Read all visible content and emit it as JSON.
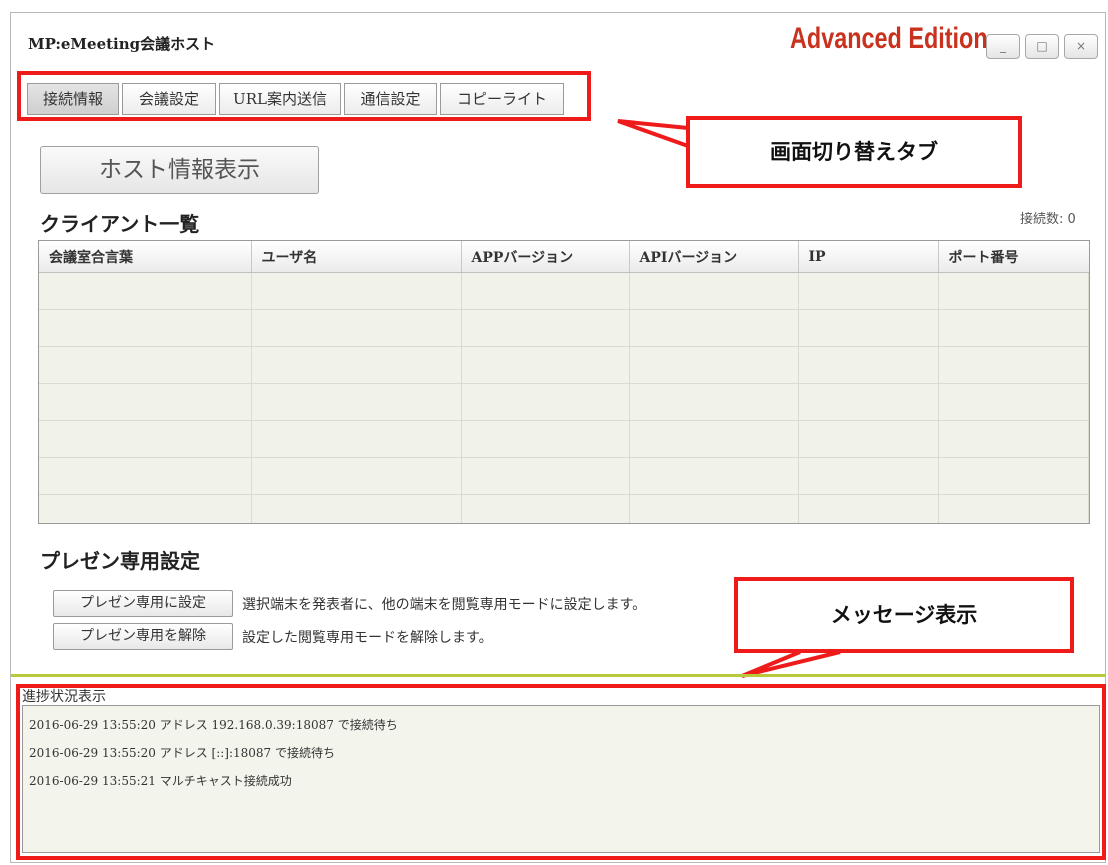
{
  "window": {
    "title": "MP:eMeeting会議ホスト",
    "edition": "Advanced Edition",
    "controls": {
      "minimize": "_",
      "maximize": "□",
      "close": "×"
    }
  },
  "tabs": [
    {
      "label": "接続情報",
      "active": true
    },
    {
      "label": "会議設定",
      "active": false
    },
    {
      "label": "URL案内送信",
      "active": false
    },
    {
      "label": "通信設定",
      "active": false
    },
    {
      "label": "コピーライト",
      "active": false
    }
  ],
  "annotations": {
    "tabs_callout": "画面切り替えタブ",
    "message_callout": "メッセージ表示",
    "highlight_color": "#ef1b1b"
  },
  "host_info_button": "ホスト情報表示",
  "client_list": {
    "title": "クライアント一覧",
    "connection_count": "接続数: 0",
    "columns": [
      "会議室合言葉",
      "ユーザ名",
      "APPバージョン",
      "APIバージョン",
      "IP",
      "ポート番号"
    ],
    "rows": []
  },
  "presentation": {
    "title": "プレゼン専用設定",
    "set_button": "プレゼン専用に設定",
    "set_description": "選択端末を発表者に、他の端末を閲覧専用モードに設定します。",
    "release_button": "プレゼン専用を解除",
    "release_description": "設定した閲覧専用モードを解除します。"
  },
  "progress": {
    "label": "進捗状況表示",
    "log": [
      "2016-06-29 13:55:20 アドレス 192.168.0.39:18087 で接続待ち",
      "2016-06-29 13:55:20 アドレス [::]:18087 で接続待ち",
      "2016-06-29 13:55:21 マルチキャスト接続成功"
    ]
  }
}
